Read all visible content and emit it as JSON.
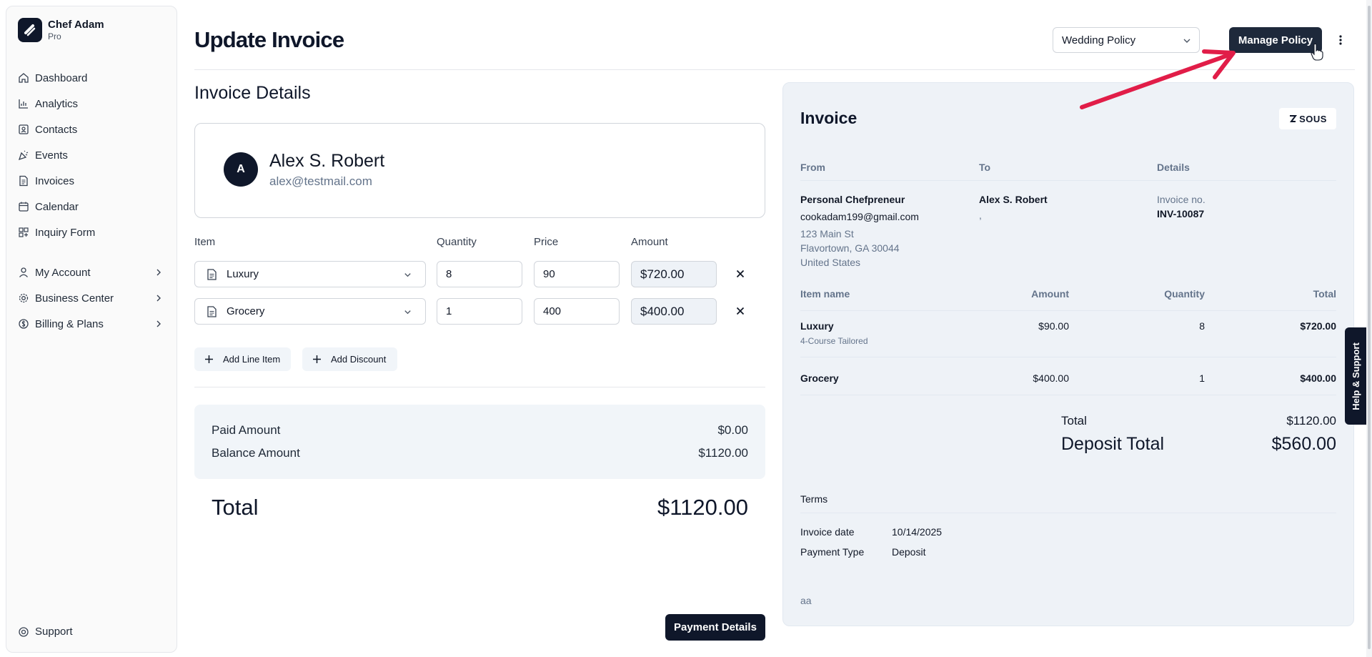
{
  "brand": {
    "name": "Chef Adam",
    "plan": "Pro"
  },
  "sidebar": {
    "items": [
      {
        "label": "Dashboard",
        "icon": "home-icon"
      },
      {
        "label": "Analytics",
        "icon": "bar-chart-icon"
      },
      {
        "label": "Contacts",
        "icon": "contact-icon"
      },
      {
        "label": "Events",
        "icon": "party-icon"
      },
      {
        "label": "Invoices",
        "icon": "invoice-icon"
      },
      {
        "label": "Calendar",
        "icon": "calendar-icon"
      },
      {
        "label": "Inquiry Form",
        "icon": "form-icon"
      }
    ],
    "groups": [
      {
        "label": "My Account",
        "icon": "user-icon"
      },
      {
        "label": "Business Center",
        "icon": "gear-icon"
      },
      {
        "label": "Billing & Plans",
        "icon": "dollar-icon"
      }
    ],
    "support": "Support"
  },
  "header": {
    "title": "Update Invoice",
    "policy_select": "Wedding Policy",
    "manage_button": "Manage Policy"
  },
  "form": {
    "section_title": "Invoice Details",
    "client": {
      "initial": "A",
      "name": "Alex S. Robert",
      "email": "alex@testmail.com"
    },
    "columns": {
      "item": "Item",
      "quantity": "Quantity",
      "price": "Price",
      "amount": "Amount"
    },
    "lines": [
      {
        "item": "Luxury",
        "quantity": "8",
        "price": "90",
        "amount": "$720.00"
      },
      {
        "item": "Grocery",
        "quantity": "1",
        "price": "400",
        "amount": "$400.00"
      }
    ],
    "add_line_item": "Add Line Item",
    "add_discount": "Add Discount",
    "paid_label": "Paid Amount",
    "paid_value": "$0.00",
    "balance_label": "Balance Amount",
    "balance_value": "$1120.00",
    "total_label": "Total",
    "total_value": "$1120.00",
    "payment_details": "Payment Details"
  },
  "invoice": {
    "title": "Invoice",
    "logo_text": "SOUS",
    "from_label": "From",
    "to_label": "To",
    "details_label": "Details",
    "from": {
      "name": "Personal Chefpreneur",
      "email": "cookadam199@gmail.com",
      "street": "123 Main St",
      "city": "Flavortown, GA 30044",
      "country": "United States"
    },
    "to": {
      "name": "Alex S. Robert",
      "extra": ","
    },
    "invoice_no_label": "Invoice no.",
    "invoice_no": "INV-10087",
    "table_headers": {
      "item_name": "Item name",
      "amount": "Amount",
      "quantity": "Quantity",
      "total": "Total"
    },
    "rows": [
      {
        "name": "Luxury",
        "sub": "4-Course Tailored",
        "amount": "$90.00",
        "quantity": "8",
        "total": "$720.00"
      },
      {
        "name": "Grocery",
        "sub": "",
        "amount": "$400.00",
        "quantity": "1",
        "total": "$400.00"
      }
    ],
    "total_label": "Total",
    "total_value": "$1120.00",
    "deposit_label": "Deposit Total",
    "deposit_value": "$560.00",
    "terms_label": "Terms",
    "invoice_date_label": "Invoice date",
    "invoice_date": "10/14/2025",
    "payment_type_label": "Payment Type",
    "payment_type": "Deposit",
    "note": "aa"
  },
  "help_tab": "Help & Support",
  "colors": {
    "primary": "#0f172a",
    "button": "#1e293b",
    "annotation_arrow": "#e11d48",
    "panel_bg": "#eef2f7"
  }
}
